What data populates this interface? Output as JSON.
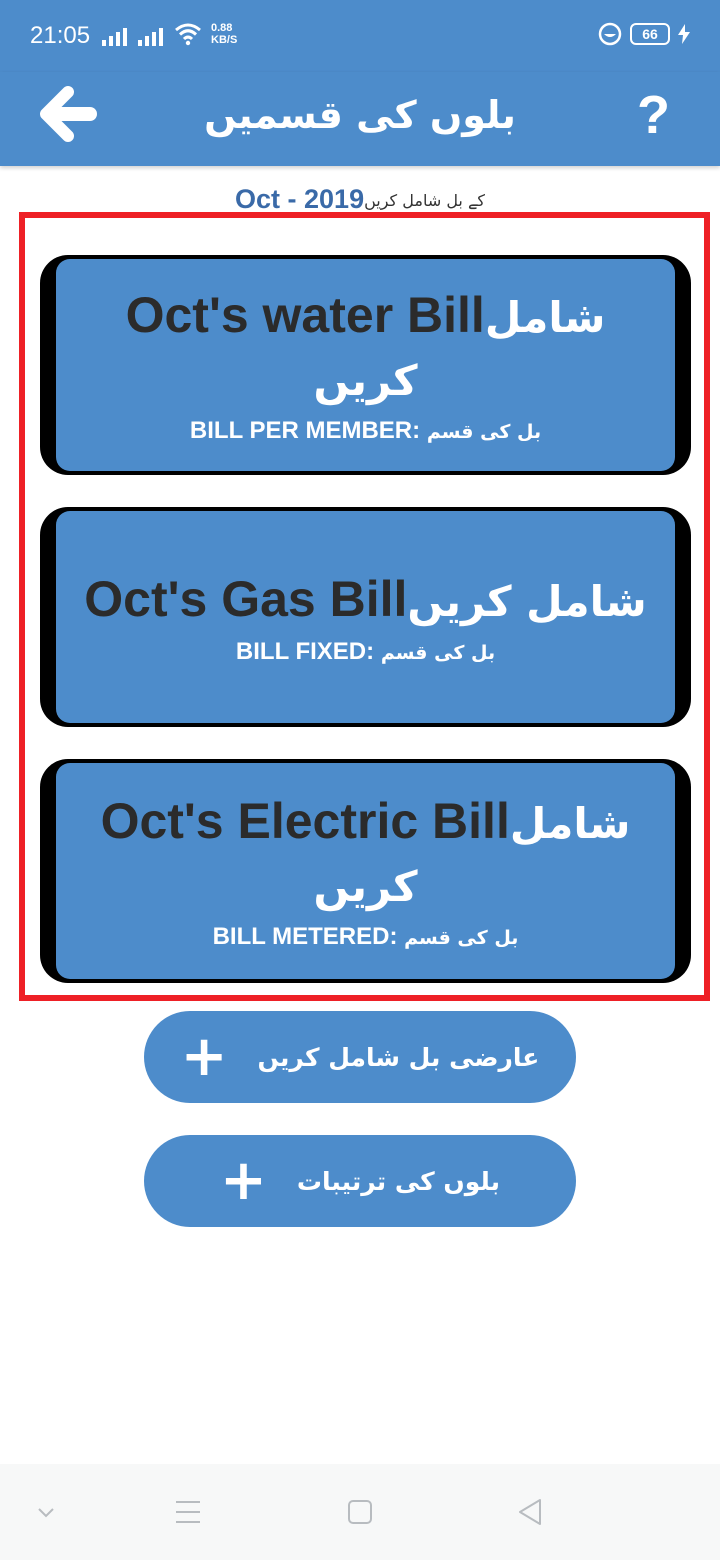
{
  "status_bar": {
    "time": "21:05",
    "net_speed_value": "0.88",
    "net_speed_unit": "KB/S",
    "battery": "66"
  },
  "header": {
    "title": "بلوں کی قسمیں",
    "help": "?"
  },
  "subtitle": {
    "period": "Oct - 2019",
    "suffix": "کے بل شامل کریں"
  },
  "bills": [
    {
      "name": "Oct's water Bill",
      "action": "شامل کریں",
      "type_label": "بل کی قسم",
      "type_value": "BILL PER MEMBER:"
    },
    {
      "name": "Oct's Gas Bill",
      "action": "شامل کریں",
      "type_label": "بل کی قسم",
      "type_value": "BILL FIXED:"
    },
    {
      "name": "Oct's Electric Bill",
      "action": "شامل کریں",
      "type_label": "بل کی قسم",
      "type_value": "BILL METERED:"
    }
  ],
  "buttons": {
    "add_temporary": "عارضی بل شامل کریں",
    "bill_settings": "بلوں کی ترتیبات",
    "plus": "+"
  },
  "colors": {
    "primary": "#4d8ccb",
    "highlight_border": "#ee2026",
    "card_shadow": "#000000",
    "period_text": "#3a6aa8"
  }
}
